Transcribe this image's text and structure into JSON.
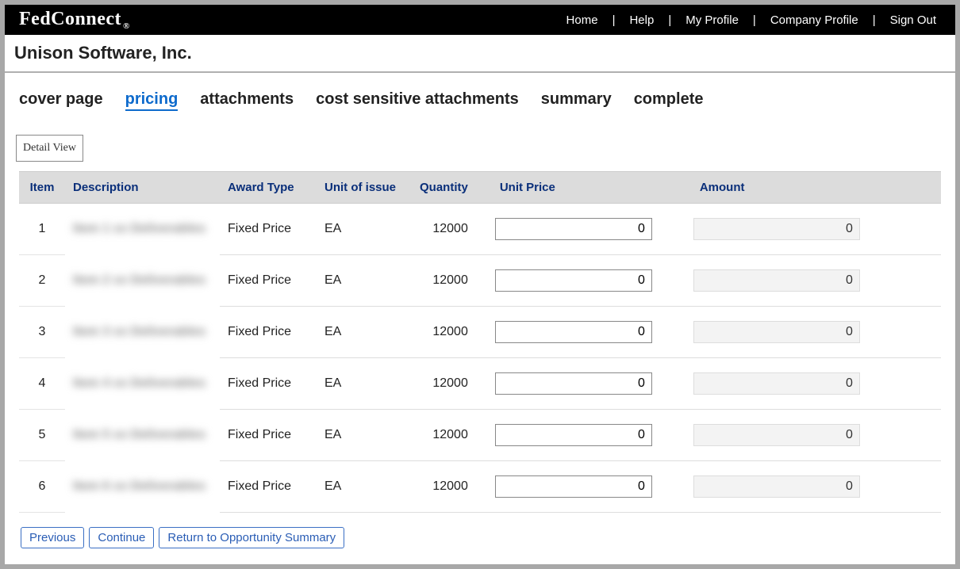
{
  "brand": "FedConnect",
  "brand_reg": "®",
  "nav": {
    "home": "Home",
    "help": "Help",
    "my_profile": "My Profile",
    "company_profile": "Company Profile",
    "sign_out": "Sign Out"
  },
  "company_name": "Unison Software, Inc.",
  "tabs": {
    "cover_page": "cover page",
    "pricing": "pricing",
    "attachments": "attachments",
    "cost_sensitive": "cost sensitive attachments",
    "summary": "summary",
    "complete": "complete"
  },
  "detail_view_label": "Detail View",
  "columns": {
    "item": "Item",
    "description": "Description",
    "award_type": "Award Type",
    "unit_of_issue": "Unit of issue",
    "quantity": "Quantity",
    "unit_price": "Unit Price",
    "amount": "Amount"
  },
  "rows": [
    {
      "item": "1",
      "description": "Item 1 xx Deliverables",
      "award_type": "Fixed Price",
      "unit": "EA",
      "qty": "12000",
      "price": "0",
      "amount": "0"
    },
    {
      "item": "2",
      "description": "Item 2 xx Deliverables",
      "award_type": "Fixed Price",
      "unit": "EA",
      "qty": "12000",
      "price": "0",
      "amount": "0"
    },
    {
      "item": "3",
      "description": "Item 3 xx Deliverables",
      "award_type": "Fixed Price",
      "unit": "EA",
      "qty": "12000",
      "price": "0",
      "amount": "0"
    },
    {
      "item": "4",
      "description": "Item 4 xx Deliverables",
      "award_type": "Fixed Price",
      "unit": "EA",
      "qty": "12000",
      "price": "0",
      "amount": "0"
    },
    {
      "item": "5",
      "description": "Item 5 xx Deliverables",
      "award_type": "Fixed Price",
      "unit": "EA",
      "qty": "12000",
      "price": "0",
      "amount": "0"
    },
    {
      "item": "6",
      "description": "Item 6 xx Deliverables",
      "award_type": "Fixed Price",
      "unit": "EA",
      "qty": "12000",
      "price": "0",
      "amount": "0"
    }
  ],
  "buttons": {
    "previous": "Previous",
    "continue": "Continue",
    "return_summary": "Return to Opportunity Summary"
  }
}
